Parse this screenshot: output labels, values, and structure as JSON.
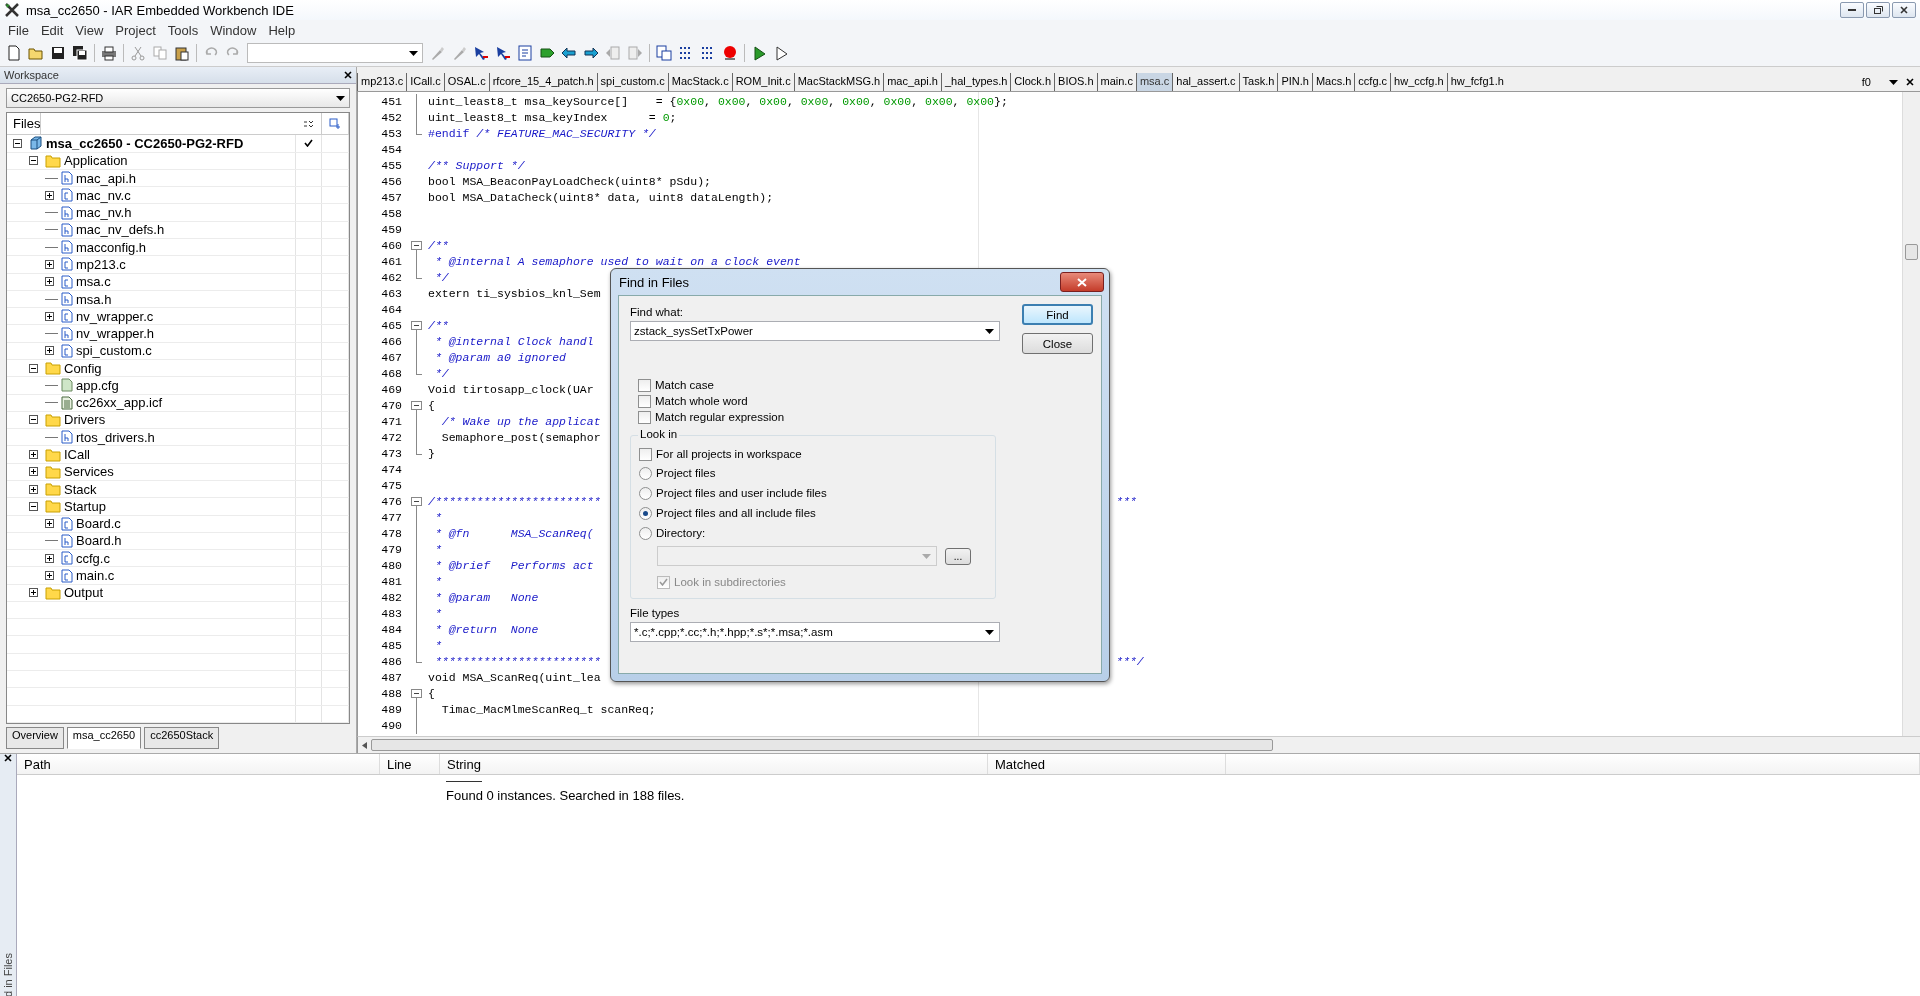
{
  "window": {
    "title": "msa_cc2650 - IAR Embedded Workbench IDE"
  },
  "menu": [
    "File",
    "Edit",
    "View",
    "Project",
    "Tools",
    "Window",
    "Help"
  ],
  "workspace": {
    "title": "Workspace",
    "configuration": "CC2650-PG2-RFD",
    "files_header": "Files",
    "project": {
      "label": "msa_cc2650 - CC2650-PG2-RFD",
      "kind": "project",
      "expanded": true,
      "checked": true,
      "children": [
        {
          "label": "Application",
          "kind": "folder",
          "expanded": true,
          "children": [
            {
              "label": "mac_api.h",
              "kind": "header"
            },
            {
              "label": "mac_nv.c",
              "kind": "source",
              "expanded": false
            },
            {
              "label": "mac_nv.h",
              "kind": "header"
            },
            {
              "label": "mac_nv_defs.h",
              "kind": "header"
            },
            {
              "label": "macconfig.h",
              "kind": "header"
            },
            {
              "label": "mp213.c",
              "kind": "source",
              "expanded": false
            },
            {
              "label": "msa.c",
              "kind": "source",
              "expanded": false
            },
            {
              "label": "msa.h",
              "kind": "header"
            },
            {
              "label": "nv_wrapper.c",
              "kind": "source",
              "expanded": false
            },
            {
              "label": "nv_wrapper.h",
              "kind": "header"
            },
            {
              "label": "spi_custom.c",
              "kind": "source",
              "expanded": false
            }
          ]
        },
        {
          "label": "Config",
          "kind": "folder",
          "expanded": true,
          "children": [
            {
              "label": "app.cfg",
              "kind": "config"
            },
            {
              "label": "cc26xx_app.icf",
              "kind": "text"
            }
          ]
        },
        {
          "label": "Drivers",
          "kind": "folder",
          "expanded": true,
          "children": [
            {
              "label": "rtos_drivers.h",
              "kind": "header"
            }
          ]
        },
        {
          "label": "ICall",
          "kind": "folder",
          "expanded": false
        },
        {
          "label": "Services",
          "kind": "folder",
          "expanded": false
        },
        {
          "label": "Stack",
          "kind": "folder",
          "expanded": false
        },
        {
          "label": "Startup",
          "kind": "folder",
          "expanded": true,
          "children": [
            {
              "label": "Board.c",
              "kind": "source",
              "expanded": false
            },
            {
              "label": "Board.h",
              "kind": "header"
            },
            {
              "label": "ccfg.c",
              "kind": "source",
              "expanded": false
            },
            {
              "label": "main.c",
              "kind": "source",
              "expanded": false
            }
          ]
        },
        {
          "label": "Output",
          "kind": "folder",
          "expanded": false
        }
      ]
    },
    "tabs": [
      {
        "label": "Overview",
        "selected": false
      },
      {
        "label": "msa_cc2650",
        "selected": true
      },
      {
        "label": "cc2650Stack",
        "selected": false
      }
    ]
  },
  "editor": {
    "tabs": [
      {
        "label": "mp213.c",
        "selected": false
      },
      {
        "label": "ICall.c",
        "selected": false
      },
      {
        "label": "OSAL.c",
        "selected": false
      },
      {
        "label": "rfcore_15_4_patch.h",
        "selected": false
      },
      {
        "label": "spi_custom.c",
        "selected": false
      },
      {
        "label": "MacStack.c",
        "selected": false
      },
      {
        "label": "ROM_Init.c",
        "selected": false
      },
      {
        "label": "MacStackMSG.h",
        "selected": false
      },
      {
        "label": "mac_api.h",
        "selected": false
      },
      {
        "label": "_hal_types.h",
        "selected": false
      },
      {
        "label": "Clock.h",
        "selected": false
      },
      {
        "label": "BIOS.h",
        "selected": false
      },
      {
        "label": "main.c",
        "selected": false
      },
      {
        "label": "msa.c",
        "selected": true
      },
      {
        "label": "hal_assert.c",
        "selected": false
      },
      {
        "label": "Task.h",
        "selected": false
      },
      {
        "label": "PIN.h",
        "selected": false
      },
      {
        "label": "Macs.h",
        "selected": false
      },
      {
        "label": "ccfg.c",
        "selected": false
      },
      {
        "label": "hw_ccfg.h",
        "selected": false
      },
      {
        "label": "hw_fcfg1.h",
        "selected": false
      }
    ],
    "function_box": "f0",
    "lines": [
      {
        "n": "451",
        "kind": "fold-mid",
        "segments": [
          {
            "text": "uint_least8_t msa_keySource[]    = {",
            "kind": "plain"
          },
          {
            "text": "0x00",
            "kind": "number"
          },
          {
            "text": ", ",
            "kind": "plain"
          },
          {
            "text": "0x00",
            "kind": "number"
          },
          {
            "text": ", ",
            "kind": "plain"
          },
          {
            "text": "0x00",
            "kind": "number"
          },
          {
            "text": ", ",
            "kind": "plain"
          },
          {
            "text": "0x00",
            "kind": "number"
          },
          {
            "text": ", ",
            "kind": "plain"
          },
          {
            "text": "0x00",
            "kind": "number"
          },
          {
            "text": ", ",
            "kind": "plain"
          },
          {
            "text": "0x00",
            "kind": "number"
          },
          {
            "text": ", ",
            "kind": "plain"
          },
          {
            "text": "0x00",
            "kind": "number"
          },
          {
            "text": ", ",
            "kind": "plain"
          },
          {
            "text": "0x00",
            "kind": "number"
          },
          {
            "text": "};",
            "kind": "plain"
          }
        ]
      },
      {
        "n": "452",
        "kind": "fold-mid",
        "segments": [
          {
            "text": "uint_least8_t msa_keyIndex      = ",
            "kind": "plain"
          },
          {
            "text": "0",
            "kind": "number"
          },
          {
            "text": ";",
            "kind": "plain"
          }
        ]
      },
      {
        "n": "453",
        "kind": "fold-end",
        "segments": [
          {
            "text": "#endif ",
            "kind": "preproc"
          },
          {
            "text": "/* FEATURE_MAC_SECURITY */",
            "kind": "comment"
          }
        ]
      },
      {
        "n": "454",
        "kind": "open"
      },
      {
        "n": "455",
        "kind": "open",
        "segments": [
          {
            "text": "/** Support */",
            "kind": "comment"
          }
        ]
      },
      {
        "n": "456",
        "kind": "open",
        "segments": [
          {
            "text": "bool MSA_BeaconPayLoadCheck(uint8* pSdu);",
            "kind": "plain"
          }
        ]
      },
      {
        "n": "457",
        "kind": "open",
        "segments": [
          {
            "text": "bool MSA_DataCheck(uint8* data, uint8 dataLength);",
            "kind": "plain"
          }
        ]
      },
      {
        "n": "458",
        "kind": "open"
      },
      {
        "n": "459",
        "kind": "open"
      },
      {
        "n": "460",
        "kind": "fold-start",
        "segments": [
          {
            "text": "/**",
            "kind": "comment"
          }
        ]
      },
      {
        "n": "461",
        "kind": "fold-mid",
        "segments": [
          {
            "text": " * @internal A semaphore used to wait on a clock event",
            "kind": "comment"
          }
        ]
      },
      {
        "n": "462",
        "kind": "fold-end",
        "segments": [
          {
            "text": " */",
            "kind": "comment"
          }
        ]
      },
      {
        "n": "463",
        "kind": "open",
        "segments": [
          {
            "text": "extern ti_sysbios_knl_Sem",
            "kind": "plain"
          }
        ]
      },
      {
        "n": "464",
        "kind": "open"
      },
      {
        "n": "465",
        "kind": "fold-start",
        "segments": [
          {
            "text": "/**",
            "kind": "comment"
          }
        ]
      },
      {
        "n": "466",
        "kind": "fold-mid",
        "segments": [
          {
            "text": " * @internal Clock handl",
            "kind": "comment"
          }
        ]
      },
      {
        "n": "467",
        "kind": "fold-mid",
        "segments": [
          {
            "text": " * @param a0 ignored",
            "kind": "comment"
          }
        ]
      },
      {
        "n": "468",
        "kind": "fold-end",
        "segments": [
          {
            "text": " */",
            "kind": "comment"
          }
        ]
      },
      {
        "n": "469",
        "kind": "open",
        "segments": [
          {
            "text": "Void tirtosapp_clock(UAr",
            "kind": "plain"
          }
        ]
      },
      {
        "n": "470",
        "kind": "fold-start",
        "segments": [
          {
            "text": "{",
            "kind": "plain"
          }
        ]
      },
      {
        "n": "471",
        "kind": "fold-mid",
        "segments": [
          {
            "text": "  /* Wake up the applicat",
            "kind": "comment"
          }
        ]
      },
      {
        "n": "472",
        "kind": "fold-mid",
        "segments": [
          {
            "text": "  Semaphore_post(semaphor",
            "kind": "plain"
          }
        ]
      },
      {
        "n": "473",
        "kind": "fold-end",
        "segments": [
          {
            "text": "}",
            "kind": "plain"
          }
        ]
      },
      {
        "n": "474",
        "kind": "open"
      },
      {
        "n": "475",
        "kind": "open"
      },
      {
        "n": "476",
        "kind": "fold-start",
        "segments": [
          {
            "text": "/************************",
            "kind": "comment"
          }
        ],
        "tail": "***"
      },
      {
        "n": "477",
        "kind": "fold-mid",
        "segments": [
          {
            "text": " *",
            "kind": "comment"
          }
        ]
      },
      {
        "n": "478",
        "kind": "fold-mid",
        "segments": [
          {
            "text": " * @fn      MSA_ScanReq(",
            "kind": "comment"
          }
        ]
      },
      {
        "n": "479",
        "kind": "fold-mid",
        "segments": [
          {
            "text": " *",
            "kind": "comment"
          }
        ]
      },
      {
        "n": "480",
        "kind": "fold-mid",
        "segments": [
          {
            "text": " * @brief   Performs act",
            "kind": "comment"
          }
        ]
      },
      {
        "n": "481",
        "kind": "fold-mid",
        "segments": [
          {
            "text": " *",
            "kind": "comment"
          }
        ]
      },
      {
        "n": "482",
        "kind": "fold-mid",
        "segments": [
          {
            "text": " * @param   None",
            "kind": "comment"
          }
        ]
      },
      {
        "n": "483",
        "kind": "fold-mid",
        "segments": [
          {
            "text": " *",
            "kind": "comment"
          }
        ]
      },
      {
        "n": "484",
        "kind": "fold-mid",
        "segments": [
          {
            "text": " * @return  None",
            "kind": "comment"
          }
        ]
      },
      {
        "n": "485",
        "kind": "fold-mid",
        "segments": [
          {
            "text": " *",
            "kind": "comment"
          }
        ]
      },
      {
        "n": "486",
        "kind": "fold-end",
        "segments": [
          {
            "text": " ************************",
            "kind": "comment"
          }
        ],
        "tail": "***/"
      },
      {
        "n": "487",
        "kind": "open",
        "segments": [
          {
            "text": "void MSA_ScanReq(uint_lea",
            "kind": "plain"
          }
        ]
      },
      {
        "n": "488",
        "kind": "fold-start",
        "segments": [
          {
            "text": "{",
            "kind": "plain"
          }
        ]
      },
      {
        "n": "489",
        "kind": "fold-mid",
        "segments": [
          {
            "text": "  Timac_MacMlmeScanReq_t scanReq;",
            "kind": "plain"
          }
        ]
      },
      {
        "n": "490",
        "kind": "fold-mid"
      }
    ]
  },
  "find_dialog": {
    "title": "Find in Files",
    "find_label": "Find what:",
    "find_value": "zstack_sysSetTxPower",
    "buttons": [
      {
        "label": "Find",
        "default": true
      },
      {
        "label": "Close",
        "default": false
      }
    ],
    "options": [
      {
        "label": "Match case",
        "checked": false
      },
      {
        "label": "Match whole word",
        "checked": false
      },
      {
        "label": "Match regular expression",
        "checked": false
      }
    ],
    "look_in": {
      "title": "Look in",
      "all_projects": {
        "label": "For all projects in workspace",
        "checked": false
      },
      "scopes": [
        {
          "label": "Project files",
          "selected": false
        },
        {
          "label": "Project files and user include files",
          "selected": false
        },
        {
          "label": "Project files and all include files",
          "selected": true
        },
        {
          "label": "Directory:",
          "selected": false
        }
      ],
      "directory": {
        "disabled": true,
        "browse": "..."
      },
      "subdirectories": {
        "label": "Look in subdirectories",
        "checked": true,
        "disabled": true
      }
    },
    "file_types_label": "File types",
    "file_types_value": "*.c;*.cpp;*.cc;*.h;*.hpp;*.s*;*.msa;*.asm"
  },
  "results": {
    "tab_label": "d in Files",
    "columns": [
      "Path",
      "Line",
      "String",
      "Matched"
    ],
    "message": "Found 0 instances. Searched in 188 files."
  }
}
